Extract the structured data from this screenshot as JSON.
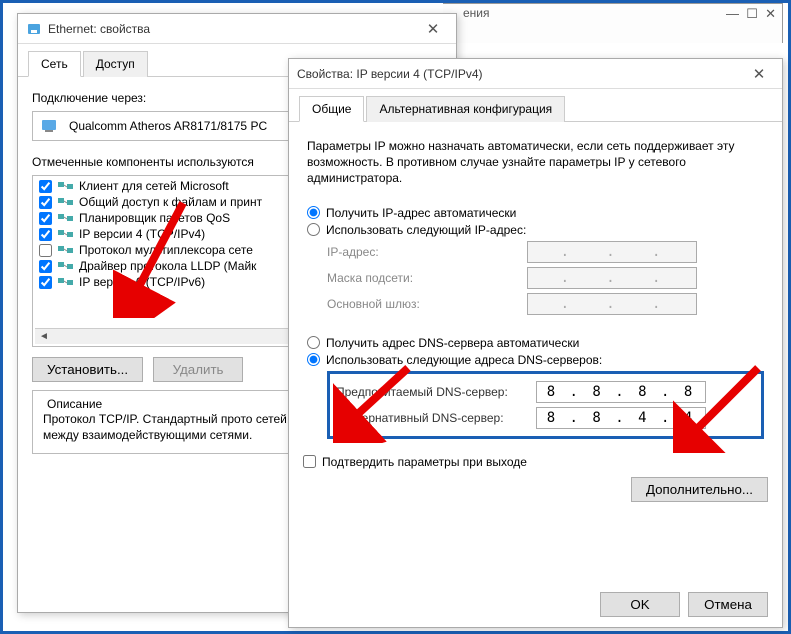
{
  "partial_top": {
    "fragment": "ения",
    "min": "—",
    "max": "☐",
    "close": "✕"
  },
  "back_window": {
    "title": "Ethernet: свойства",
    "tabs": [
      "Сеть",
      "Доступ"
    ],
    "active_tab": 0,
    "connect_label": "Подключение через:",
    "adapter": "Qualcomm Atheros AR8171/8175 PC",
    "components_label": "Отмеченные компоненты используются",
    "components": [
      {
        "checked": true,
        "label": "Клиент для сетей Microsoft"
      },
      {
        "checked": true,
        "label": "Общий доступ к файлам и принт"
      },
      {
        "checked": true,
        "label": "Планировщик пакетов QoS"
      },
      {
        "checked": true,
        "label": "IP версии 4 (TCP/IPv4)"
      },
      {
        "checked": false,
        "label": "Протокол мультиплексора сете"
      },
      {
        "checked": true,
        "label": "Драйвер протокола LLDP (Майк"
      },
      {
        "checked": true,
        "label": "IP версии 6 (TCP/IPv6)"
      }
    ],
    "install_btn": "Установить...",
    "remove_btn": "Удалить",
    "desc_title": "Описание",
    "desc_text": "Протокол TCP/IP. Стандартный прото сетей, обеспечивающий связь между взаимодействующими сетями."
  },
  "front_window": {
    "title": "Свойства: IP версии 4 (TCP/IPv4)",
    "tabs": [
      "Общие",
      "Альтернативная конфигурация"
    ],
    "active_tab": 0,
    "intro": "Параметры IP можно назначать автоматически, если сеть поддерживает эту возможность. В противном случае узнайте параметры IP у сетевого администратора.",
    "radio_ip_auto": "Получить IP-адрес автоматически",
    "radio_ip_manual": "Использовать следующий IP-адрес:",
    "ip_label": "IP-адрес:",
    "mask_label": "Маска подсети:",
    "gateway_label": "Основной шлюз:",
    "radio_dns_auto": "Получить адрес DNS-сервера автоматически",
    "radio_dns_manual": "Использовать следующие адреса DNS-серверов:",
    "dns1_label": "Предпочитаемый DNS-сервер:",
    "dns2_label": "Альтернативный DNS-сервер:",
    "dns1_value": "8 . 8 . 8 . 8",
    "dns2_value": "8 . 8 . 4 . 4",
    "confirm_chk": "Подтвердить параметры при выходе",
    "advanced_btn": "Дополнительно...",
    "ok_btn": "OK",
    "cancel_btn": "Отмена"
  }
}
